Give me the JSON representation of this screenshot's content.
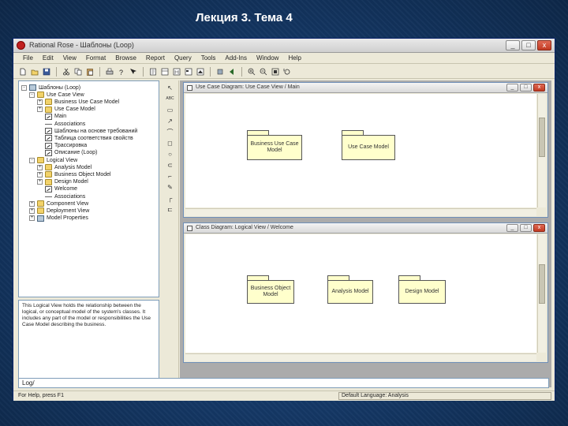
{
  "slide": {
    "title": "Лекция 3. Тема 4"
  },
  "window": {
    "title": "Rational Rose - Шаблоны (Loop)",
    "min": "_",
    "max": "□",
    "close": "x"
  },
  "menu": [
    "File",
    "Edit",
    "View",
    "Format",
    "Browse",
    "Report",
    "Query",
    "Tools",
    "Add-Ins",
    "Window",
    "Help"
  ],
  "toolbar_icons": [
    "new-icon",
    "open-icon",
    "save-icon",
    "cut-icon",
    "copy-icon",
    "paste-icon",
    "print-icon",
    "help-icon",
    "context-help-icon",
    "view-doc-icon",
    "browse-class-icon",
    "browse-interaction-icon",
    "browse-component-icon",
    "browse-deployment-icon",
    "browse-parent-icon",
    "browse-previous-icon",
    "zoom-in-icon",
    "zoom-out-icon",
    "fit-icon",
    "undo-fit-icon"
  ],
  "browser": {
    "items": [
      {
        "label": "Шаблоны (Loop)",
        "icon": "model",
        "indent": 0,
        "exp": "-"
      },
      {
        "label": "Use Case View",
        "icon": "folder",
        "indent": 1,
        "exp": "-"
      },
      {
        "label": "Business Use Case Model",
        "icon": "folder",
        "indent": 2,
        "exp": "+"
      },
      {
        "label": "Use Case Model",
        "icon": "folder",
        "indent": 2,
        "exp": "+"
      },
      {
        "label": "Main",
        "icon": "diagram",
        "indent": 2,
        "exp": ""
      },
      {
        "label": "Associations",
        "icon": "assoc",
        "indent": 2,
        "exp": ""
      },
      {
        "label": "Шаблоны на основе требований",
        "icon": "diagram",
        "indent": 2,
        "exp": ""
      },
      {
        "label": "Таблица соответствия свойств",
        "icon": "diagram",
        "indent": 2,
        "exp": ""
      },
      {
        "label": "Трассировка",
        "icon": "diagram",
        "indent": 2,
        "exp": ""
      },
      {
        "label": "Описание (Loop)",
        "icon": "diagram",
        "indent": 2,
        "exp": ""
      },
      {
        "label": "Logical View",
        "icon": "folder",
        "indent": 1,
        "exp": "-"
      },
      {
        "label": "Analysis Model",
        "icon": "folder",
        "indent": 2,
        "exp": "+"
      },
      {
        "label": "Business Object Model",
        "icon": "folder",
        "indent": 2,
        "exp": "+"
      },
      {
        "label": "Design Model",
        "icon": "folder",
        "indent": 2,
        "exp": "+"
      },
      {
        "label": "Welcome",
        "icon": "diagram",
        "indent": 2,
        "exp": ""
      },
      {
        "label": "Associations",
        "icon": "assoc",
        "indent": 2,
        "exp": ""
      },
      {
        "label": "Component View",
        "icon": "folder",
        "indent": 1,
        "exp": "+"
      },
      {
        "label": "Deployment View",
        "icon": "folder",
        "indent": 1,
        "exp": "+"
      },
      {
        "label": "Model Properties",
        "icon": "model",
        "indent": 1,
        "exp": "+"
      }
    ]
  },
  "documentation": "This Logical View holds the relationship between the logical, or conceptual model of the system's classes. It includes any part of the model or responsibilities the Use Case Model describing the business.",
  "toolbox": [
    "↖",
    "ABC",
    "▭",
    "↗",
    "⌒",
    "◻",
    "○",
    "⊂",
    "⌐",
    "✎",
    "┌",
    "⊏"
  ],
  "use_case_window": {
    "title": "Use Case Diagram: Use Case View / Main",
    "packages": [
      "Business Use Case Model",
      "Use Case Model"
    ]
  },
  "class_window": {
    "title": "Class Diagram: Logical View / Welcome",
    "packages": [
      "Business Object Model",
      "Analysis Model",
      "Design Model"
    ]
  },
  "log_input": "Log/",
  "status": {
    "left": "For Help, press F1",
    "right": "Default Language: Analysis"
  }
}
